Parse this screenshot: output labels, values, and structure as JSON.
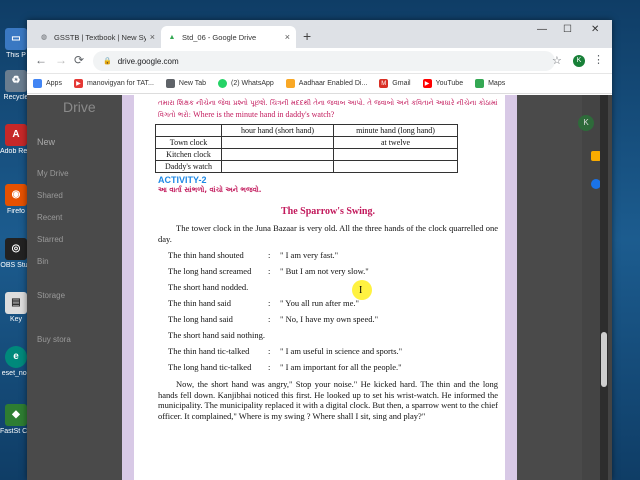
{
  "desktop": {
    "icons": [
      {
        "label": "This P",
        "color": "#3a78c2",
        "glyph": "▭"
      },
      {
        "label": "Recycle",
        "color": "#6a7d8f",
        "glyph": "♻"
      },
      {
        "label": "Adob Reade",
        "color": "#c62828",
        "glyph": "A"
      },
      {
        "label": "Firefo",
        "color": "#e65100",
        "glyph": "◉"
      },
      {
        "label": "OBS Stud",
        "color": "#222222",
        "glyph": "◎"
      },
      {
        "label": "Key",
        "color": "#dddddd",
        "glyph": "▤"
      },
      {
        "label": "eset_noc",
        "color": "#00897b",
        "glyph": "e"
      },
      {
        "label": "FastSt Captu",
        "color": "#2e7d32",
        "glyph": "◆"
      }
    ]
  },
  "browser": {
    "tabs": [
      {
        "title": "GSSTB | Textbook | New Syllabus",
        "close": "×"
      },
      {
        "title": "Std_06 - Google Drive",
        "close": "×"
      }
    ],
    "new_tab": "+",
    "window_controls": {
      "minimize": "—",
      "maximize": "☐",
      "close": "✕"
    },
    "nav": {
      "back": "←",
      "forward": "→",
      "reload": "⟳"
    },
    "url": "drive.google.com",
    "star": "☆",
    "profile_initial": "K",
    "menu": "⋮",
    "bookmarks": [
      {
        "label": "Apps",
        "color": "#4285f4"
      },
      {
        "label": "manovigyan for TAT...",
        "color": "#e53935"
      },
      {
        "label": "New Tab",
        "color": "#5f6368"
      },
      {
        "label": "(2) WhatsApp",
        "color": "#25d366"
      },
      {
        "label": "Aadhaar Enabled Di...",
        "color": "#f9a825"
      },
      {
        "label": "Gmail",
        "color": "#d93025"
      },
      {
        "label": "YouTube",
        "color": "#ff0000"
      },
      {
        "label": "Maps",
        "color": "#34a853"
      }
    ]
  },
  "drive": {
    "logo": "Drive",
    "new_button": "New",
    "sidebar": [
      "My Drive",
      "Shared",
      "Recent",
      "Starred",
      "Bin",
      "Storage",
      "Buy stora"
    ],
    "avatar": "K"
  },
  "document": {
    "gujarati_instruction": "તમારા શિક્ષક નીચેના જેવા પ્રશ્નો પૂછશે. ચિત્રની મદદથી તેના જવાબ આપો. તે જવાબો અને કવિતાને આધારે નીચેના કોઠામાં વિગતો ભરો:",
    "english_question": "Where is the minute hand in daddy's watch?",
    "table": {
      "headers": [
        "",
        "hour hand (short hand)",
        "minute hand (long hand)"
      ],
      "rows": [
        [
          "Town clock",
          "",
          "at twelve"
        ],
        [
          "Kitchen clock",
          "",
          ""
        ],
        [
          "Daddy's watch",
          "",
          ""
        ]
      ]
    },
    "activity_title": "ACTIVITY-2",
    "activity_gujarati": "આ વાર્તા સાંભળો, વાંચો અને ભજવો.",
    "story_title": "The Sparrow's Swing.",
    "intro": "The tower clock in the Juna Bazaar is very old. All the three hands of the clock quarrelled one day.",
    "dialogue": [
      {
        "speaker": "The thin hand shouted",
        "colon": ":",
        "line": "\" I am very fast.\""
      },
      {
        "speaker": "The long hand screamed",
        "colon": ":",
        "line": "\" But I am not very slow.\""
      },
      {
        "speaker": "The short hand nodded.",
        "colon": "",
        "line": ""
      },
      {
        "speaker": "The thin hand said",
        "colon": ":",
        "line": "\" You all run after me.\""
      },
      {
        "speaker": "The long hand said",
        "colon": ":",
        "line": "\" No, I have my own speed.\""
      },
      {
        "speaker": "The short hand said nothing.",
        "colon": "",
        "line": ""
      },
      {
        "speaker": "The thin hand tic-talked",
        "colon": ":",
        "line": "\" I am useful in science and sports.\""
      },
      {
        "speaker": "The long hand tic-talked",
        "colon": ":",
        "line": "\" I am important for all the people.\""
      }
    ],
    "closing": "Now, the short hand was angry,\" Stop your noise.\" He kicked hard. The thin and the long hands fell down. Kanjibhai noticed this first. He looked up to set his wrist-watch. He informed the municipality. The municipality replaced it with a digital clock. But then, a sparrow went to the chief officer. It complained,\" Where is my swing ? Where shall I sit, sing and play?\""
  }
}
